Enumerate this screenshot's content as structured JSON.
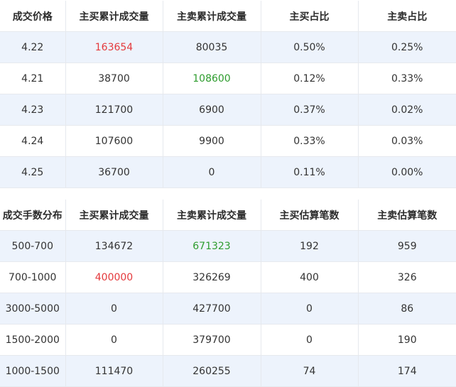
{
  "price_table": {
    "headers": [
      "成交价格",
      "主买累计成交量",
      "主卖累计成交量",
      "主买占比",
      "主卖占比"
    ],
    "rows": [
      {
        "price": "4.22",
        "buy_vol": "163654",
        "sell_vol": "80035",
        "buy_pct": "0.50%",
        "sell_pct": "0.25%"
      },
      {
        "price": "4.21",
        "buy_vol": "38700",
        "sell_vol": "108600",
        "buy_pct": "0.12%",
        "sell_pct": "0.33%"
      },
      {
        "price": "4.23",
        "buy_vol": "121700",
        "sell_vol": "6900",
        "buy_pct": "0.37%",
        "sell_pct": "0.02%"
      },
      {
        "price": "4.24",
        "buy_vol": "107600",
        "sell_vol": "9900",
        "buy_pct": "0.33%",
        "sell_pct": "0.03%"
      },
      {
        "price": "4.25",
        "buy_vol": "36700",
        "sell_vol": "0",
        "buy_pct": "0.11%",
        "sell_pct": "0.00%"
      }
    ]
  },
  "lot_table": {
    "headers": [
      "成交手数分布",
      "主买累计成交量",
      "主卖累计成交量",
      "主买估算笔数",
      "主卖估算笔数"
    ],
    "rows": [
      {
        "range": "500-700",
        "buy_vol": "134672",
        "sell_vol": "671323",
        "buy_cnt": "192",
        "sell_cnt": "959"
      },
      {
        "range": "700-1000",
        "buy_vol": "400000",
        "sell_vol": "326269",
        "buy_cnt": "400",
        "sell_cnt": "326"
      },
      {
        "range": "3000-5000",
        "buy_vol": "0",
        "sell_vol": "427700",
        "buy_cnt": "0",
        "sell_cnt": "86"
      },
      {
        "range": "1500-2000",
        "buy_vol": "0",
        "sell_vol": "379700",
        "buy_cnt": "0",
        "sell_cnt": "190"
      },
      {
        "range": "1000-1500",
        "buy_vol": "111470",
        "sell_vol": "260255",
        "buy_cnt": "74",
        "sell_cnt": "174"
      }
    ]
  },
  "colors": {
    "highlight_buy": "#e4393c",
    "highlight_sell": "#2e9c2e",
    "stripe": "#edf3fc"
  }
}
